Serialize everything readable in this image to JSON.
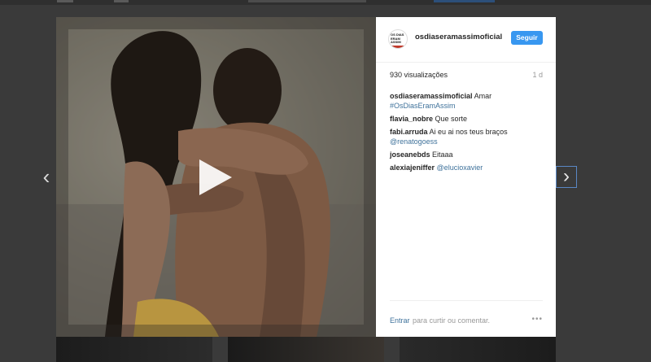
{
  "post": {
    "username": "osdiaseramassimoficial",
    "follow_label": "Seguir",
    "views": "930 visualizações",
    "time": "1 d",
    "avatar_text": "OS DIAS ERAM ASSIM"
  },
  "comments": [
    {
      "user": "osdiaseramassimoficial",
      "text": "Amar",
      "link": "#OsDiasEramAssim"
    },
    {
      "user": "flavia_nobre",
      "text": "Que sorte",
      "link": ""
    },
    {
      "user": "fabi.arruda",
      "text": "Ai eu ai nos teus braços",
      "link": "@renatogoess"
    },
    {
      "user": "joseanebds",
      "text": "Eitaaa",
      "link": ""
    },
    {
      "user": "alexiajeniffer",
      "text": "",
      "link": "@elucioxavier"
    }
  ],
  "footer": {
    "login_label": "Entrar",
    "login_rest": "para curtir ou comentar.",
    "more_icon": "•••"
  },
  "nav": {
    "prev_icon": "‹",
    "next_icon": "›"
  }
}
